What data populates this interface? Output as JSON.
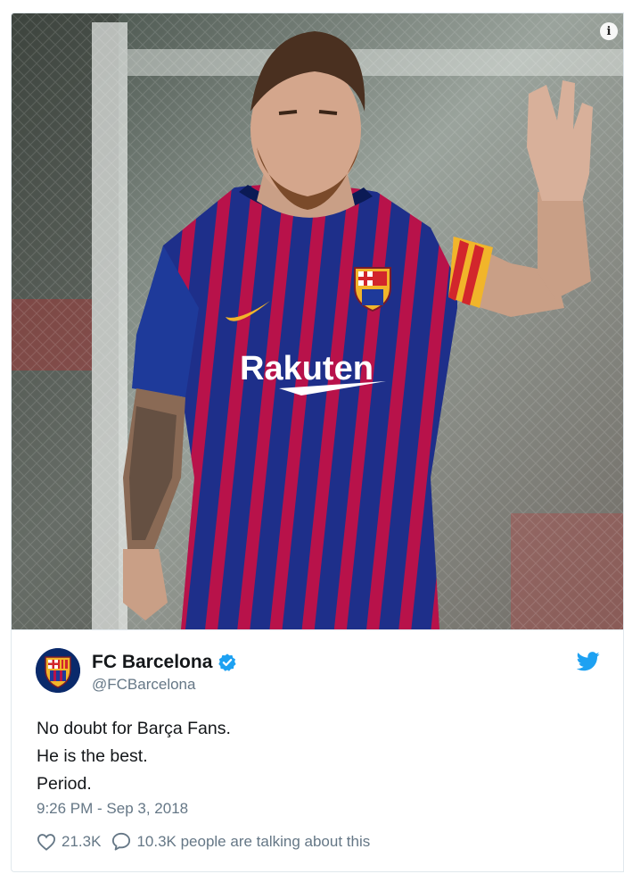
{
  "media": {
    "alt_icon": "info-icon",
    "jersey_sponsor": "Rakuten"
  },
  "tweet": {
    "author": {
      "display_name": "FC Barcelona",
      "handle": "@FCBarcelona",
      "verified": true,
      "avatar_icon": "fc-barcelona-crest"
    },
    "platform_icon": "twitter-bird-icon",
    "lines": [
      "No doubt for Barça Fans.",
      "He is the best.",
      "Period."
    ],
    "timestamp": "9:26 PM - Sep 3, 2018",
    "likes": "21.3K",
    "talking": "10.3K people are talking about this"
  },
  "colors": {
    "twitter_blue": "#1da1f2",
    "secondary_text": "#657786",
    "primary_text": "#14171a",
    "kit_blue": "#1e3a9a",
    "kit_red": "#b8124a"
  }
}
